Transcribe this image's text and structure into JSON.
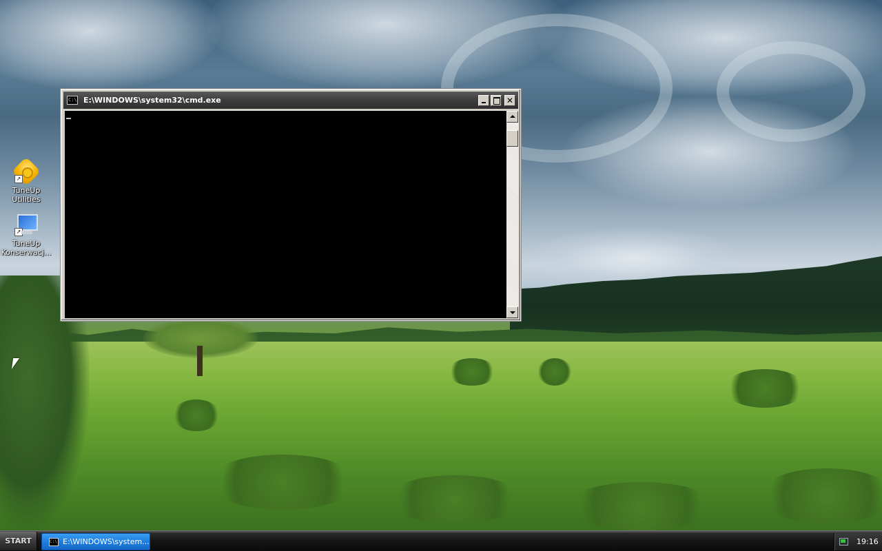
{
  "desktop": {
    "icons": [
      {
        "line1": "TuneUp",
        "line2": "Utilities",
        "icon": "tuneup-utilities-icon"
      },
      {
        "line1": "TuneUp",
        "line2": "Konserwacj...",
        "icon": "tuneup-konserwacja-icon"
      }
    ]
  },
  "cmd_window": {
    "title": "E:\\WINDOWS\\system32\\cmd.exe",
    "icon_text": "C:\\",
    "console_text": ""
  },
  "taskbar": {
    "start_label": "START",
    "task_label": "E:\\WINDOWS\\system...",
    "task_icon_text": "C:\\",
    "clock": "19:16"
  },
  "colors": {
    "console_bg": "#000000",
    "titlebar": "#3f3f3f",
    "task_button": "#1f7fe0",
    "taskbar": "#151515"
  }
}
